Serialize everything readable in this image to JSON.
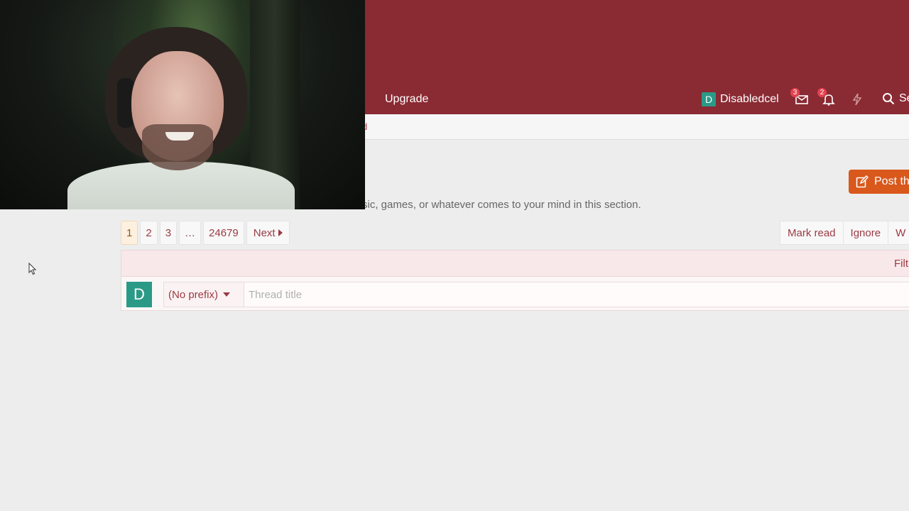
{
  "header": {
    "nav_upgrade": "Upgrade",
    "username": "Disabledcel",
    "avatar_letter": "D",
    "inbox_count": "3",
    "alerts_count": "2",
    "search_label": "Se"
  },
  "subnav": {
    "partial_text": "d"
  },
  "post_button": {
    "label": "Post th"
  },
  "forum": {
    "description": "sic, games, or whatever comes to your mind in this section."
  },
  "pagination": {
    "pages": [
      "1",
      "2",
      "3",
      "…",
      "24679"
    ],
    "current": "1",
    "next_label": "Next"
  },
  "actions": {
    "mark_read": "Mark read",
    "ignore": "Ignore",
    "watch": "W"
  },
  "filter": {
    "label": "Filt"
  },
  "quick_thread": {
    "avatar_letter": "D",
    "prefix_selected": "(No prefix)",
    "title_placeholder": "Thread title"
  },
  "colors": {
    "header_bg": "#8a2a33",
    "accent_link": "#9a3a44",
    "post_button_bg": "#d9581c",
    "avatar_bg": "#2a9a87",
    "badge_bg": "#e2424f"
  },
  "icons": {
    "inbox": "envelope-icon",
    "alerts": "bell-icon",
    "whats_new": "bolt-icon",
    "search": "search-icon",
    "post": "edit-icon",
    "next": "caret-right-icon",
    "prefix": "caret-down-icon"
  }
}
